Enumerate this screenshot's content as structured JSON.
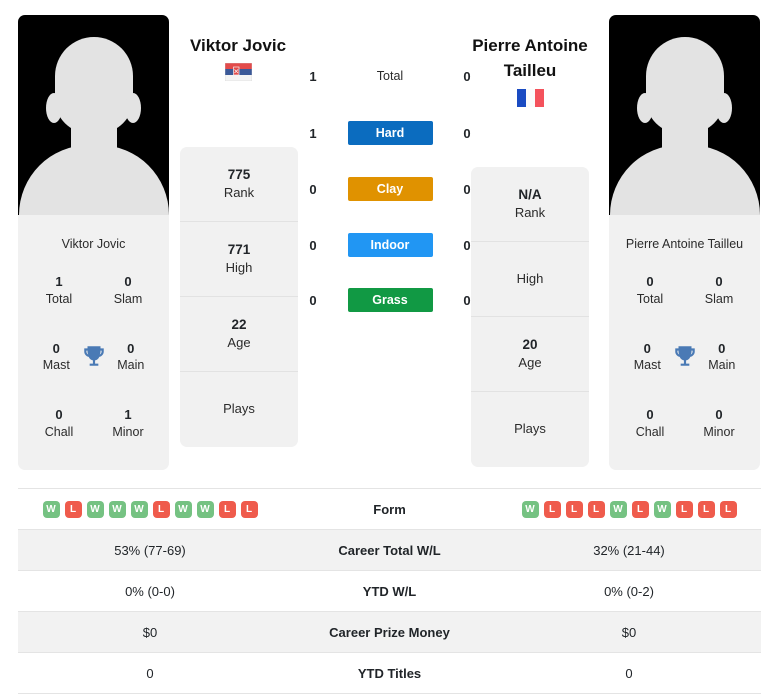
{
  "players": {
    "left": {
      "name": "Viktor Jovic",
      "card_name": "Viktor Jovic",
      "flag": "serbia-flag",
      "rank": "775",
      "rank_label": "Rank",
      "high": "771",
      "high_label": "High",
      "age": "22",
      "age_label": "Age",
      "plays": "Plays",
      "titles": {
        "total": "1",
        "total_label": "Total",
        "slam": "0",
        "slam_label": "Slam",
        "mast": "0",
        "mast_label": "Mast",
        "main": "0",
        "main_label": "Main",
        "chall": "0",
        "chall_label": "Chall",
        "minor": "1",
        "minor_label": "Minor"
      },
      "form": [
        "W",
        "L",
        "W",
        "W",
        "W",
        "L",
        "W",
        "W",
        "L",
        "L"
      ],
      "career_wl": "53% (77-69)",
      "ytd_wl": "0% (0-0)",
      "prize_money": "$0",
      "ytd_titles": "0"
    },
    "right": {
      "name": "Pierre Antoine Tailleu",
      "card_name": "Pierre Antoine Tailleu",
      "flag": "france-flag",
      "rank": "N/A",
      "rank_label": "Rank",
      "high": "",
      "high_label": "High",
      "age": "20",
      "age_label": "Age",
      "plays": "Plays",
      "titles": {
        "total": "0",
        "total_label": "Total",
        "slam": "0",
        "slam_label": "Slam",
        "mast": "0",
        "mast_label": "Mast",
        "main": "0",
        "main_label": "Main",
        "chall": "0",
        "chall_label": "Chall",
        "minor": "0",
        "minor_label": "Minor"
      },
      "form": [
        "W",
        "L",
        "L",
        "L",
        "W",
        "L",
        "W",
        "L",
        "L",
        "L"
      ],
      "career_wl": "32% (21-44)",
      "ytd_wl": "0% (0-2)",
      "prize_money": "$0",
      "ytd_titles": "0"
    }
  },
  "surfaces": [
    {
      "label": "Total",
      "left": "1",
      "right": "0",
      "color": "transparent",
      "plain": true
    },
    {
      "label": "Hard",
      "left": "1",
      "right": "0",
      "color": "#0b6cbf",
      "plain": false
    },
    {
      "label": "Clay",
      "left": "0",
      "right": "0",
      "color": "#e09200",
      "plain": false
    },
    {
      "label": "Indoor",
      "left": "0",
      "right": "0",
      "color": "#2196f3",
      "plain": false
    },
    {
      "label": "Grass",
      "left": "0",
      "right": "0",
      "color": "#119944",
      "plain": false
    }
  ],
  "table_rows": [
    {
      "label": "Form",
      "type": "form"
    },
    {
      "label": "Career Total W/L",
      "type": "text",
      "left": "53% (77-69)",
      "right": "32% (21-44)"
    },
    {
      "label": "YTD W/L",
      "type": "text",
      "left": "0% (0-0)",
      "right": "0% (0-2)"
    },
    {
      "label": "Career Prize Money",
      "type": "text",
      "left": "$0",
      "right": "$0"
    },
    {
      "label": "YTD Titles",
      "type": "text",
      "left": "0",
      "right": "0"
    }
  ],
  "colors": {
    "hard": "#0b6cbf",
    "clay": "#e09200",
    "indoor": "#2196f3",
    "grass": "#119944",
    "win": "#75c282",
    "loss": "#ef5b4c",
    "trophy": "#4a7ab5",
    "card_bg": "#f1f1f1"
  }
}
